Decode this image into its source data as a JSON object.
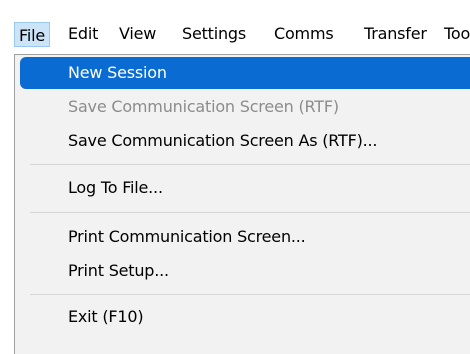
{
  "menubar": {
    "items": [
      {
        "label": "File"
      },
      {
        "label": "Edit"
      },
      {
        "label": "View"
      },
      {
        "label": "Settings"
      },
      {
        "label": "Comms"
      },
      {
        "label": "Transfer"
      },
      {
        "label": "Too"
      }
    ]
  },
  "file_menu": {
    "items": [
      {
        "label": "New Session",
        "state": "highlighted"
      },
      {
        "label": "Save Communication Screen (RTF)",
        "state": "disabled"
      },
      {
        "label": "Save Communication Screen As (RTF)...",
        "state": "enabled"
      },
      {
        "label": "Log To File...",
        "state": "enabled"
      },
      {
        "label": "Print Communication Screen...",
        "state": "enabled"
      },
      {
        "label": "Print Setup...",
        "state": "enabled"
      },
      {
        "label": "Exit (F10)",
        "state": "enabled"
      }
    ]
  },
  "colors": {
    "highlight": "#0a6cd3",
    "menu_background": "#f2f2f2",
    "disabled_text": "#8c8c8c",
    "active_menubar_item": "#cce4f7"
  }
}
